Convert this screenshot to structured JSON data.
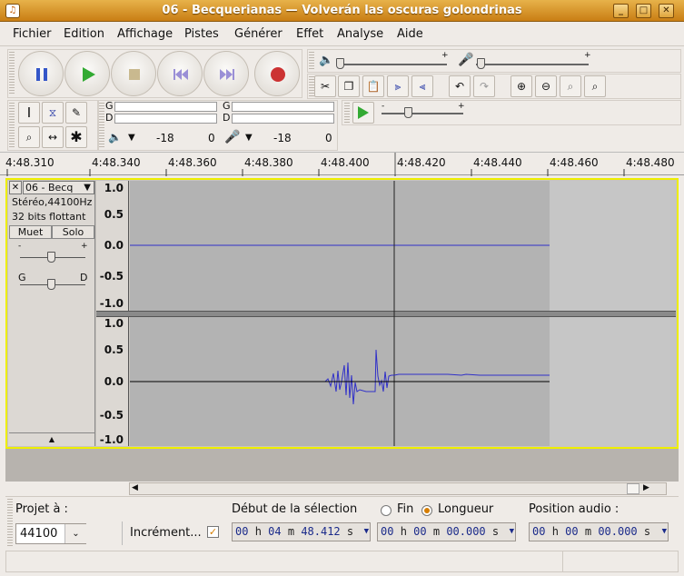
{
  "window": {
    "title": "06 - Becquerianas — Volverán las oscuras golondrinas",
    "minimize": "_",
    "maximize": "□",
    "close": "✕"
  },
  "menu": [
    {
      "label": "Fichier"
    },
    {
      "label": "Edition"
    },
    {
      "label": "Affichage"
    },
    {
      "label": "Pistes"
    },
    {
      "label": "Générer"
    },
    {
      "label": "Effet"
    },
    {
      "label": "Analyse"
    },
    {
      "label": "Aide"
    }
  ],
  "meters": {
    "out_left": "G",
    "out_right": "D",
    "in_left": "G",
    "in_right": "D",
    "ticks": [
      "-18",
      "0",
      "-18",
      "0"
    ]
  },
  "ruler": [
    "4:48.310",
    "4:48.340",
    "4:48.360",
    "4:48.380",
    "4:48.400",
    "4:48.420",
    "4:48.440",
    "4:48.460",
    "4:48.480"
  ],
  "track": {
    "close": "✕",
    "name": "06 - Becq",
    "format": "Stéréo,44100Hz",
    "depth": "32 bits flottant",
    "mute": "Muet",
    "solo": "Solo",
    "gain_min": "-",
    "gain_max": "+",
    "pan_left": "G",
    "pan_right": "D",
    "collapse": "▲",
    "vscale": [
      "1.0",
      "0.5",
      "0.0",
      "-0.5",
      "-1.0"
    ]
  },
  "selection": {
    "project_label": "Projet à :",
    "project_rate": "44100",
    "snap_label": "Incrément...",
    "start_label": "Début de la sélection",
    "end_label": "Fin",
    "length_label": "Longueur",
    "start_value": [
      "00",
      "h",
      "04",
      "m",
      "48.412",
      "s"
    ],
    "length_value": [
      "00",
      "h",
      "00",
      "m",
      "00.000",
      "s"
    ],
    "audio_pos_label": "Position audio :",
    "audio_pos_value": [
      "00",
      "h",
      "00",
      "m",
      "00.000",
      "s"
    ]
  },
  "icons": [
    "pause-icon",
    "play-icon",
    "stop-icon",
    "skip-start-icon",
    "skip-end-icon",
    "record-icon",
    "speaker-icon",
    "microphone-icon",
    "cut-icon",
    "copy-icon",
    "paste-icon",
    "trim-icon",
    "silence-icon",
    "undo-icon",
    "redo-icon",
    "zoom-in-icon",
    "zoom-out-icon",
    "fit-selection-icon",
    "fit-project-icon",
    "select-tool-icon",
    "envelope-tool-icon",
    "draw-tool-icon",
    "zoom-tool-icon",
    "timeshift-tool-icon",
    "multi-tool-icon"
  ]
}
